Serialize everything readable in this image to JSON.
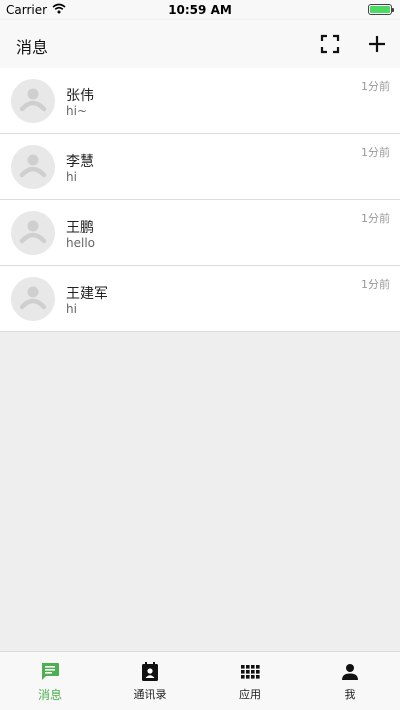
{
  "status_bar": {
    "carrier": "Carrier",
    "time": "10:59 AM"
  },
  "header": {
    "title": "消息",
    "scan_icon": "fullscreen-icon",
    "add_icon": "plus-icon"
  },
  "conversations": [
    {
      "name": "张伟",
      "message": "hi~",
      "time": "1分前"
    },
    {
      "name": "李慧",
      "message": "hi",
      "time": "1分前"
    },
    {
      "name": "王鹏",
      "message": "hello",
      "time": "1分前"
    },
    {
      "name": "王建军",
      "message": "hi",
      "time": "1分前"
    }
  ],
  "tabs": [
    {
      "label": "消息",
      "icon": "chat-icon",
      "active": true
    },
    {
      "label": "通讯录",
      "icon": "contacts-icon",
      "active": false
    },
    {
      "label": "应用",
      "icon": "apps-grid-icon",
      "active": false
    },
    {
      "label": "我",
      "icon": "person-icon",
      "active": false
    }
  ],
  "colors": {
    "accent": "#4caf50",
    "background": "#eeeeee",
    "bar": "#f8f8f8"
  }
}
